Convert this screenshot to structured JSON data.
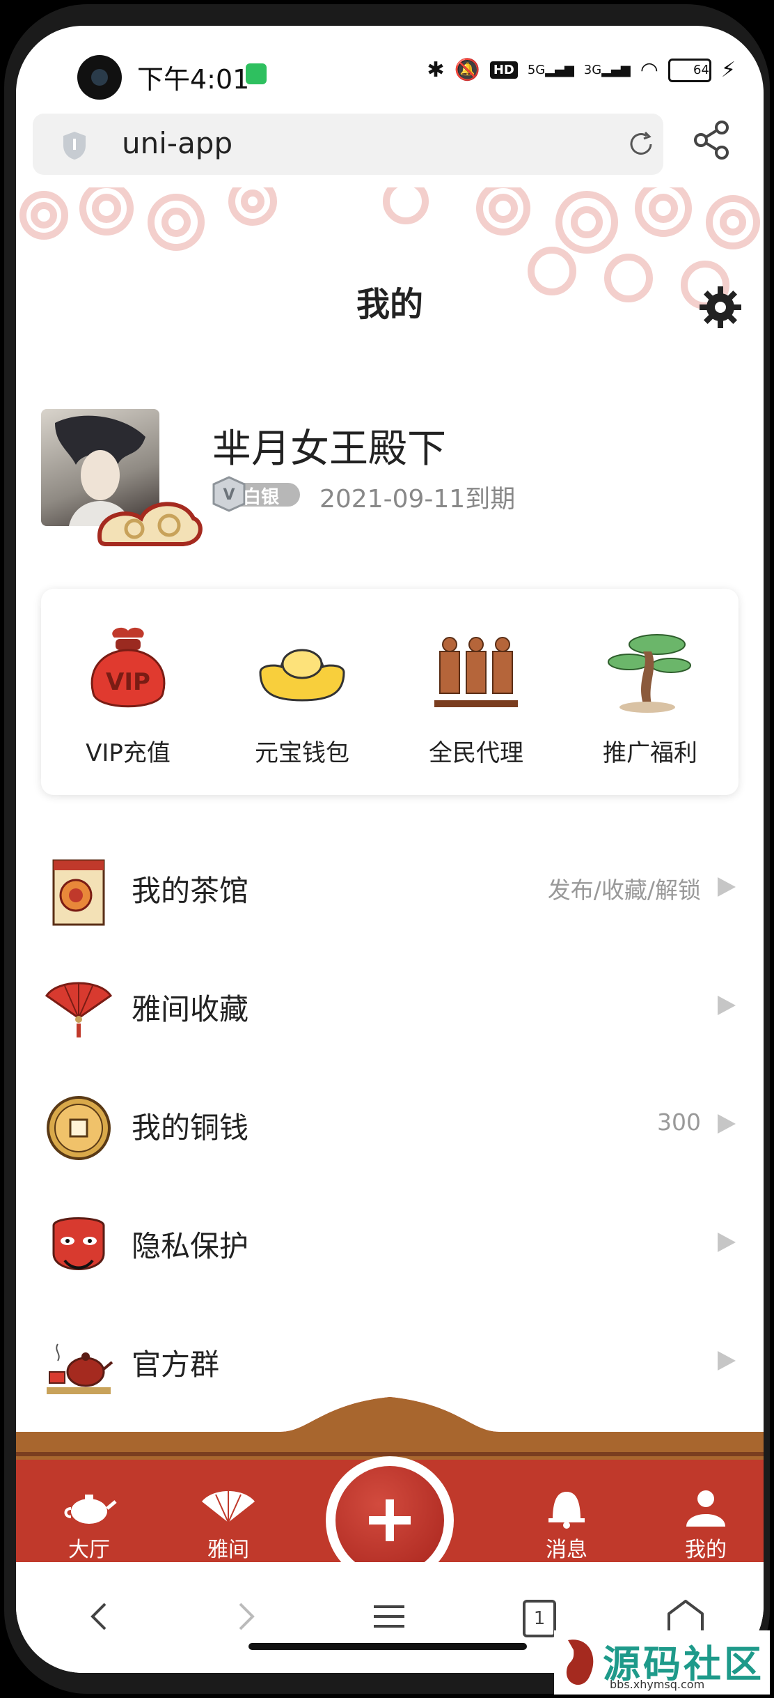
{
  "status_bar": {
    "time": "下午4:01",
    "network_hd": "HD",
    "network_5g": "5G",
    "network_3g": "3G",
    "battery": "64"
  },
  "browser": {
    "url": "uni-app"
  },
  "page": {
    "title": "我的"
  },
  "profile": {
    "username": "芈月女王殿下",
    "badge": "白银",
    "expire": "2021-09-11到期"
  },
  "quick_actions": [
    {
      "label": "VIP充值",
      "icon": "vip-bag-icon"
    },
    {
      "label": "元宝钱包",
      "icon": "gold-ingot-icon"
    },
    {
      "label": "全民代理",
      "icon": "terracotta-warriors-icon"
    },
    {
      "label": "推广福利",
      "icon": "pine-tree-icon"
    }
  ],
  "menu": [
    {
      "label": "我的茶馆",
      "sub": "发布/收藏/解锁",
      "icon": "teahouse-icon"
    },
    {
      "label": "雅间收藏",
      "sub": "",
      "icon": "fan-icon"
    },
    {
      "label": "我的铜钱",
      "sub": "300",
      "icon": "copper-coin-icon"
    },
    {
      "label": "隐私保护",
      "sub": "",
      "icon": "opera-mask-icon"
    },
    {
      "label": "官方群",
      "sub": "",
      "icon": "teapot-icon"
    }
  ],
  "tabbar": [
    {
      "label": "大厅",
      "icon": "teapot-tab-icon"
    },
    {
      "label": "雅间",
      "icon": "fan-tab-icon"
    },
    {
      "label": "消息",
      "icon": "bell-icon"
    },
    {
      "label": "我的",
      "icon": "profile-tab-icon"
    }
  ],
  "browser_nav": {
    "tabs_count": "1"
  },
  "watermark": {
    "text": "源码社区",
    "sub": "bbs.xhymsq.com"
  },
  "colors": {
    "tabbar_red": "#c0392b",
    "accent_gold": "#c8a25a"
  }
}
